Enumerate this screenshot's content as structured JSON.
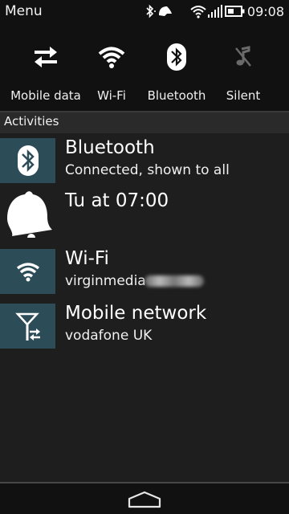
{
  "status_bar": {
    "menu_label": "Menu",
    "time": "09:08",
    "icons": [
      "bluetooth-status-icon",
      "wifi-status-icon",
      "signal-bars-icon",
      "battery-icon"
    ]
  },
  "quick_settings": [
    {
      "label": "Mobile data",
      "icon": "mobile-data-icon",
      "active": true
    },
    {
      "label": "Wi-Fi",
      "icon": "wifi-icon",
      "active": true
    },
    {
      "label": "Bluetooth",
      "icon": "bluetooth-icon",
      "active": true
    },
    {
      "label": "Silent",
      "icon": "silent-icon",
      "active": false
    }
  ],
  "activities": {
    "header": "Activities",
    "items": [
      {
        "title": "Bluetooth",
        "subtitle": "Connected, shown to all",
        "icon": "bluetooth-icon"
      },
      {
        "title": "Tu at 07:00",
        "subtitle": "",
        "icon": "alarm-bell-icon"
      },
      {
        "title": "Wi-Fi",
        "subtitle": "virginmedia",
        "icon": "wifi-icon"
      },
      {
        "title": "Mobile network",
        "subtitle": "vodafone UK",
        "icon": "mobile-network-icon"
      }
    ]
  },
  "colors": {
    "background": "#1e1e1e",
    "bar": "#111111",
    "icon_tile": "#2c4c58",
    "section_header": "#2a2a2a"
  },
  "navbar": {
    "home_icon": "home-icon"
  }
}
